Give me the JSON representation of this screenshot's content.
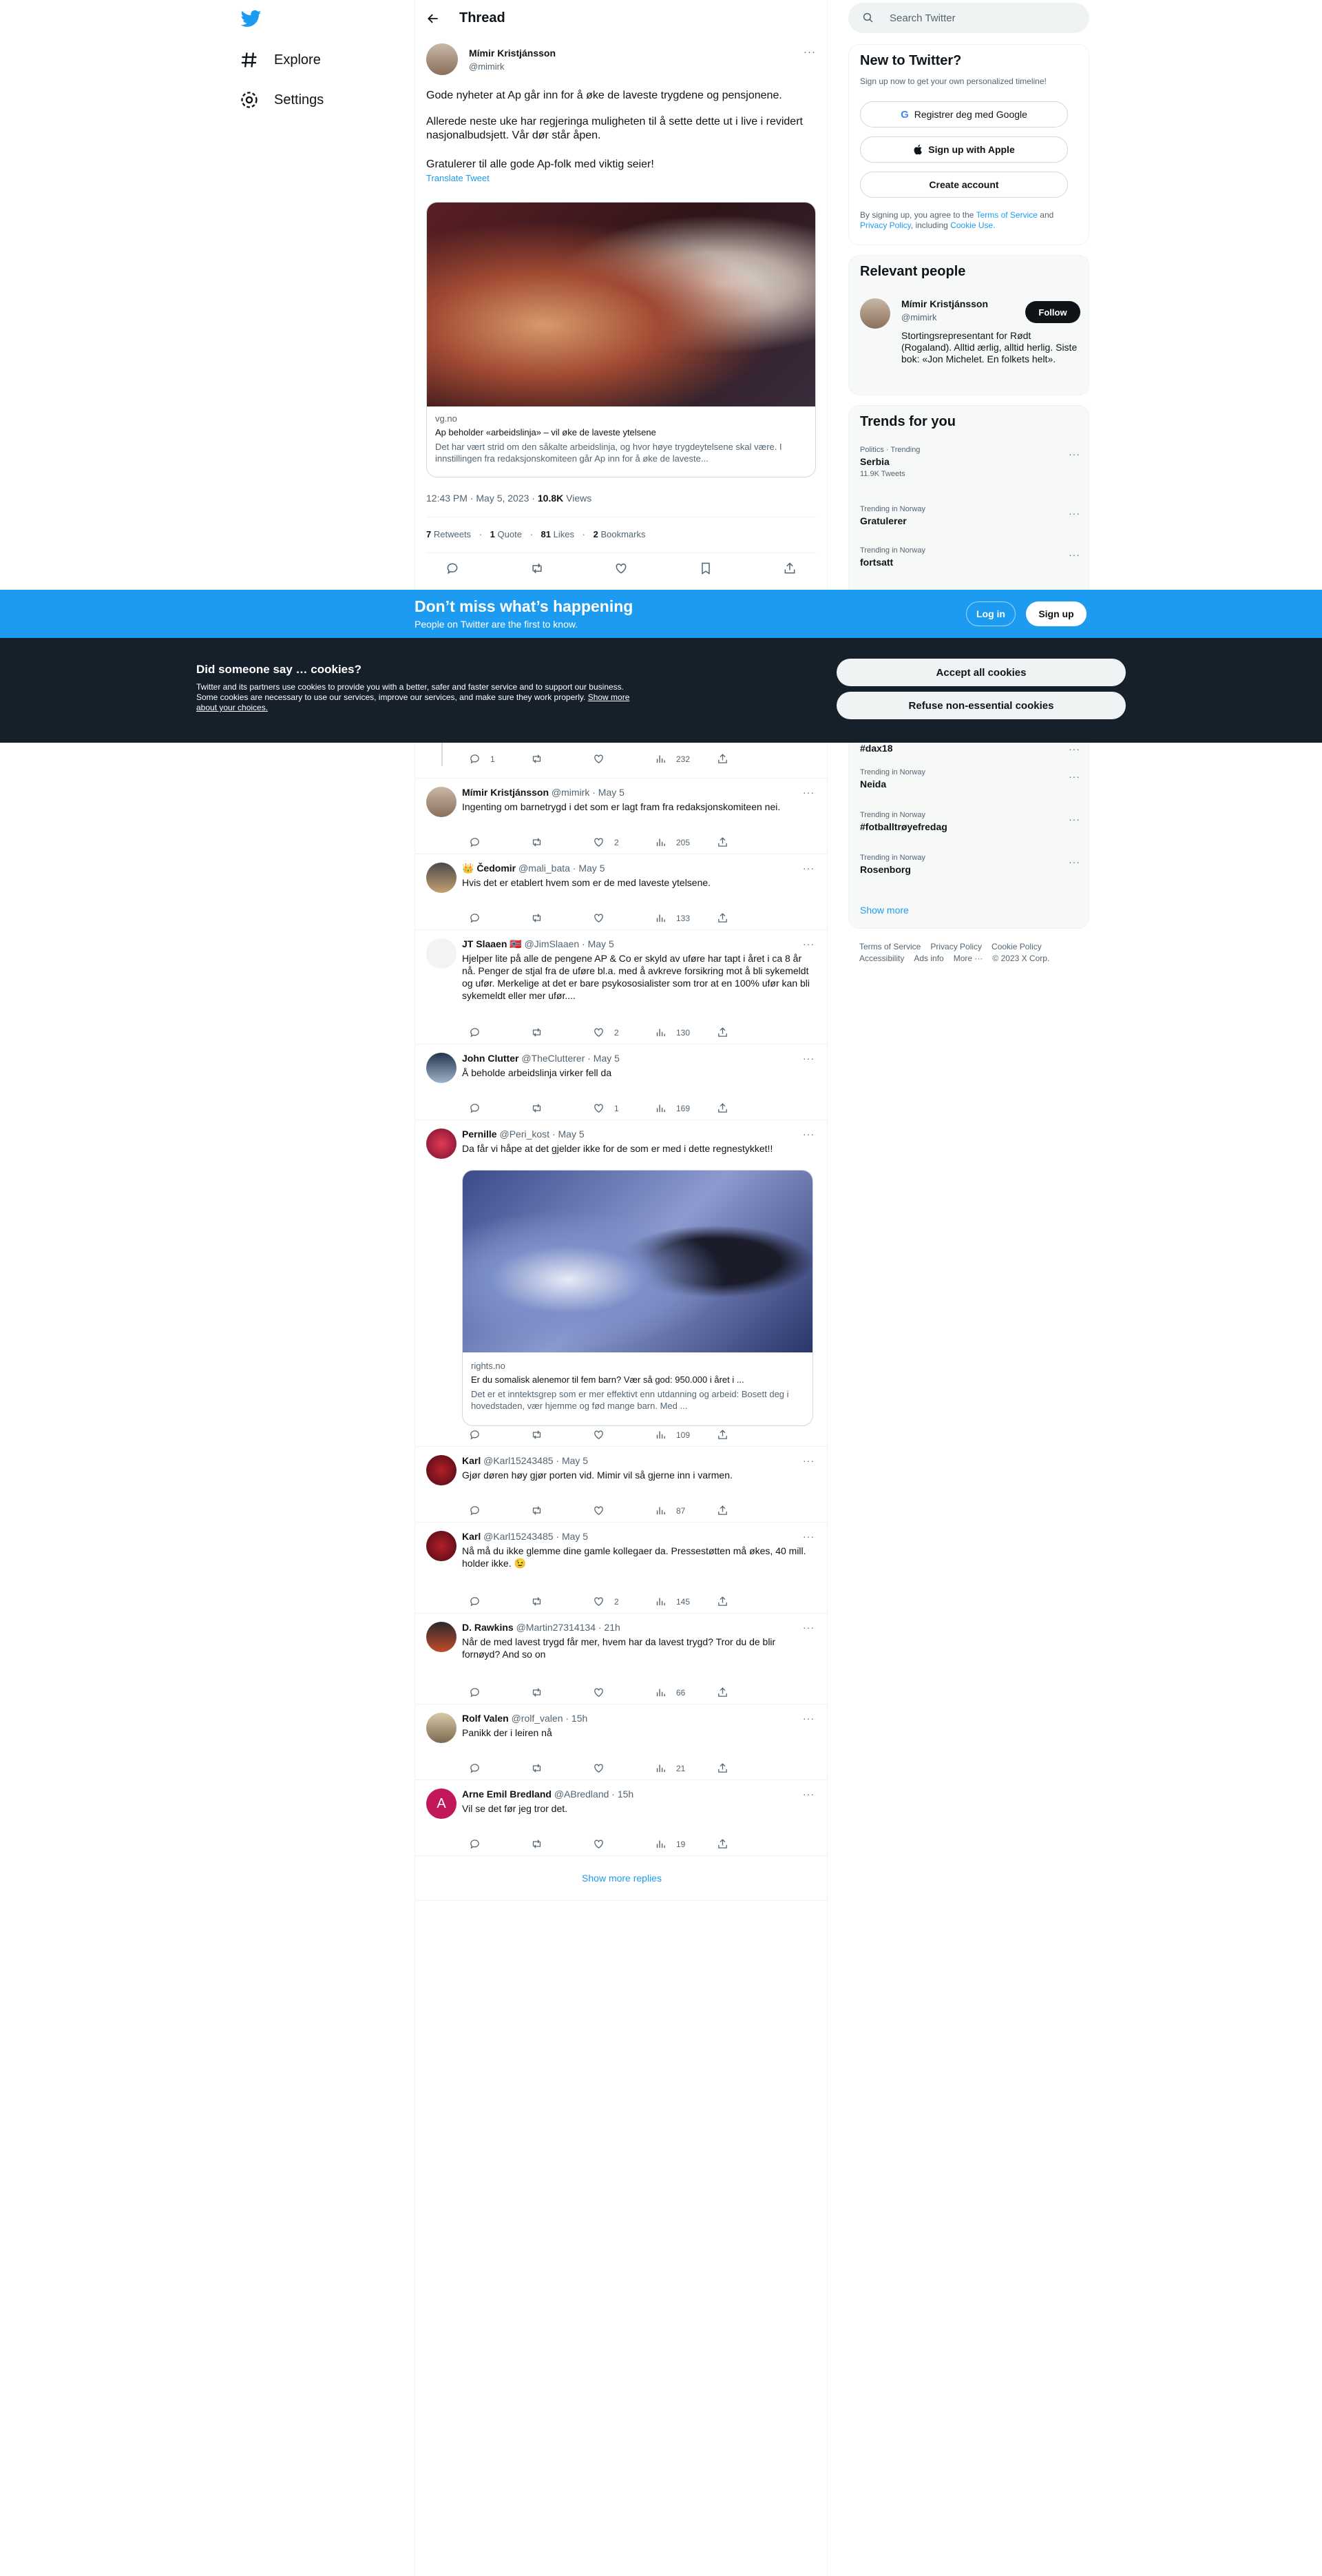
{
  "colors": {
    "brand": "#1d9bf0",
    "dark": "#0f1419",
    "muted": "#536471",
    "cookie_bg": "#15202b"
  },
  "nav": {
    "items": [
      {
        "label": "Explore",
        "icon": "hashtag-icon"
      },
      {
        "label": "Settings",
        "icon": "gear-icon"
      }
    ]
  },
  "header": {
    "title": "Thread"
  },
  "main_tweet": {
    "name": "Mímir Kristjánsson",
    "handle": "@mimirk",
    "text": [
      "Gode nyheter at Ap går inn for å øke de laveste trygdene og pensjonene.",
      "Allerede neste uke har regjeringa muligheten til å sette dette ut i live i revidert nasjonalbudsjett. Vår dør står åpen.",
      "Gratulerer til alle gode Ap-folk med viktig seier!"
    ],
    "translate": "Translate Tweet",
    "card": {
      "domain": "vg.no",
      "title": "Ap beholder «arbeidslinja» – vil øke de laveste ytelsene",
      "desc": "Det har vært strid om den såkalte arbeidslinja, og hvor høye trygdeytelsene skal være. I innstillingen fra redaksjonskomiteen går Ap inn for å øke de laveste..."
    },
    "time": "12:43 PM · May 5, 2023",
    "views_count": "10.8K",
    "views_label": "Views",
    "stats": [
      {
        "n": "7",
        "l": "Retweets"
      },
      {
        "n": "1",
        "l": "Quote"
      },
      {
        "n": "81",
        "l": "Likes"
      },
      {
        "n": "2",
        "l": "Bookmarks"
      }
    ]
  },
  "replies": [
    {
      "name": "Mímir Kristjánsson",
      "handle": "@mimirk · May 5",
      "text": "Ingenting om barnetrygd i det som er lagt fram fra redaksjonskomiteen nei.",
      "reply": "",
      "like": "2",
      "views": "205"
    },
    {
      "name": "👑 Čedomir",
      "handle": "@mali_bata · May 5",
      "text": "Hvis det er etablert hvem som er de med laveste ytelsene.",
      "reply": "",
      "like": "",
      "views": "133"
    },
    {
      "name": "JT Slaaen",
      "flag": "🇳🇴",
      "handle": "@JimSlaaen · May 5",
      "text": "Hjelper lite på alle de pengene AP & Co er skyld av uføre har tapt i året i ca 8 år nå. Penger de stjal fra de uføre bl.a. med å avkreve forsikring mot å bli sykemeldt og ufør. Merkelige at det er bare psykososialister som tror at en 100% ufør kan bli sykemeldt eller mer ufør....",
      "reply": "",
      "like": "2",
      "views": "130"
    },
    {
      "name": "John Clutter",
      "handle": "@TheClutterer · May 5",
      "text": "Å beholde arbeidslinja virker fell da",
      "reply": "",
      "like": "1",
      "views": "169"
    },
    {
      "name": "Pernille",
      "handle": "@Peri_kost · May 5",
      "text": "Da får vi håpe at det  gjelder ikke for de som er med i dette regnestykket!!",
      "card": {
        "domain": "rights.no",
        "title": "Er du somalisk alenemor til fem barn? Vær så god: 950.000 i året i ...",
        "desc": "Det er et inntektsgrep som er mer effektivt enn utdanning og arbeid: Bosett deg i hovedstaden, vær hjemme og fød mange barn. Med ..."
      },
      "reply": "",
      "like": "",
      "views": "109"
    },
    {
      "name": "Karl",
      "handle": "@Karl15243485 · May 5",
      "text": "Gjør døren høy gjør porten vid.  Mimir vil så gjerne inn i varmen.",
      "reply": "",
      "like": "",
      "views": "87"
    },
    {
      "name": "Karl",
      "handle": "@Karl15243485 · May 5",
      "text": "Nå må du ikke glemme dine gamle kollegaer da.  Pressestøtten må økes, 40 mill. holder ikke. 😉",
      "reply": "",
      "like": "2",
      "views": "145"
    },
    {
      "name": "D. Rawkins",
      "handle": "@Martin27314134 · 21h",
      "text": "Når de med lavest trygd får mer, hvem har da lavest trygd? Tror du de blir fornøyd? And so on",
      "reply": "",
      "like": "",
      "views": "66"
    },
    {
      "name": "Rolf Valen",
      "handle": "@rolf_valen · 15h",
      "text": "Panikk der i leiren nå",
      "reply": "",
      "like": "",
      "views": "21"
    },
    {
      "name": "Arne Emil Bredland",
      "handle": "@ABredland · 15h",
      "text": "Vil se det før jeg tror det.",
      "avatar_letter": "A",
      "reply": "",
      "like": "",
      "views": "19"
    }
  ],
  "partial_reply": {
    "reply": "1",
    "views": "232"
  },
  "show_more": "Show more replies",
  "search": {
    "placeholder": "Search Twitter"
  },
  "signup": {
    "title": "New to Twitter?",
    "sub": "Sign up now to get your own personalized timeline!",
    "google": "Registrer deg med Google",
    "apple": "Sign up with Apple",
    "create": "Create account",
    "legal_1": "By signing up, you agree to the",
    "tos": "Terms of Service",
    "and": "and",
    "privacy": "Privacy Policy",
    "incl": ", including",
    "cookie": "Cookie Use."
  },
  "relevant": {
    "title": "Relevant people",
    "name": "Mímir Kristjánsson",
    "handle": "@mimirk",
    "follow": "Follow",
    "bio": "Stortingsrepresentant for Rødt (Rogaland). Alltid ærlig, alltid herlig. Siste bok: «Jon Michelet. En folkets helt»."
  },
  "trends": {
    "title": "Trends for you",
    "items": [
      {
        "cat": "Politics · Trending",
        "name": "Serbia",
        "count": "11.9K Tweets"
      },
      {
        "cat": "Trending in Norway",
        "name": "Gratulerer"
      },
      {
        "cat": "Trending in Norway",
        "name": "fortsatt"
      }
    ],
    "items2": [
      {
        "name": "#dax18"
      },
      {
        "cat": "Trending in Norway",
        "name": "Neida"
      },
      {
        "cat": "Trending in Norway",
        "name": "#fotballtrøyefredag"
      },
      {
        "cat": "Trending in Norway",
        "name": "Rosenborg"
      }
    ],
    "show_more": "Show more"
  },
  "footer": {
    "links": [
      "Terms of Service",
      "Privacy Policy",
      "Cookie Policy",
      "Accessibility",
      "Ads info",
      "More ···",
      "© 2023 X Corp."
    ]
  },
  "banner": {
    "title": "Don’t miss what’s happening",
    "sub": "People on Twitter are the first to know.",
    "login": "Log in",
    "signup": "Sign up"
  },
  "cookie": {
    "title": "Did someone say … cookies?",
    "body": "Twitter and its partners use cookies to provide you with a better, safer and faster service and to support our business. Some cookies are necessary to use our services, improve our services, and make sure they work properly.",
    "link": "Show more about your choices.",
    "accept": "Accept all cookies",
    "refuse": "Refuse non-essential cookies"
  }
}
